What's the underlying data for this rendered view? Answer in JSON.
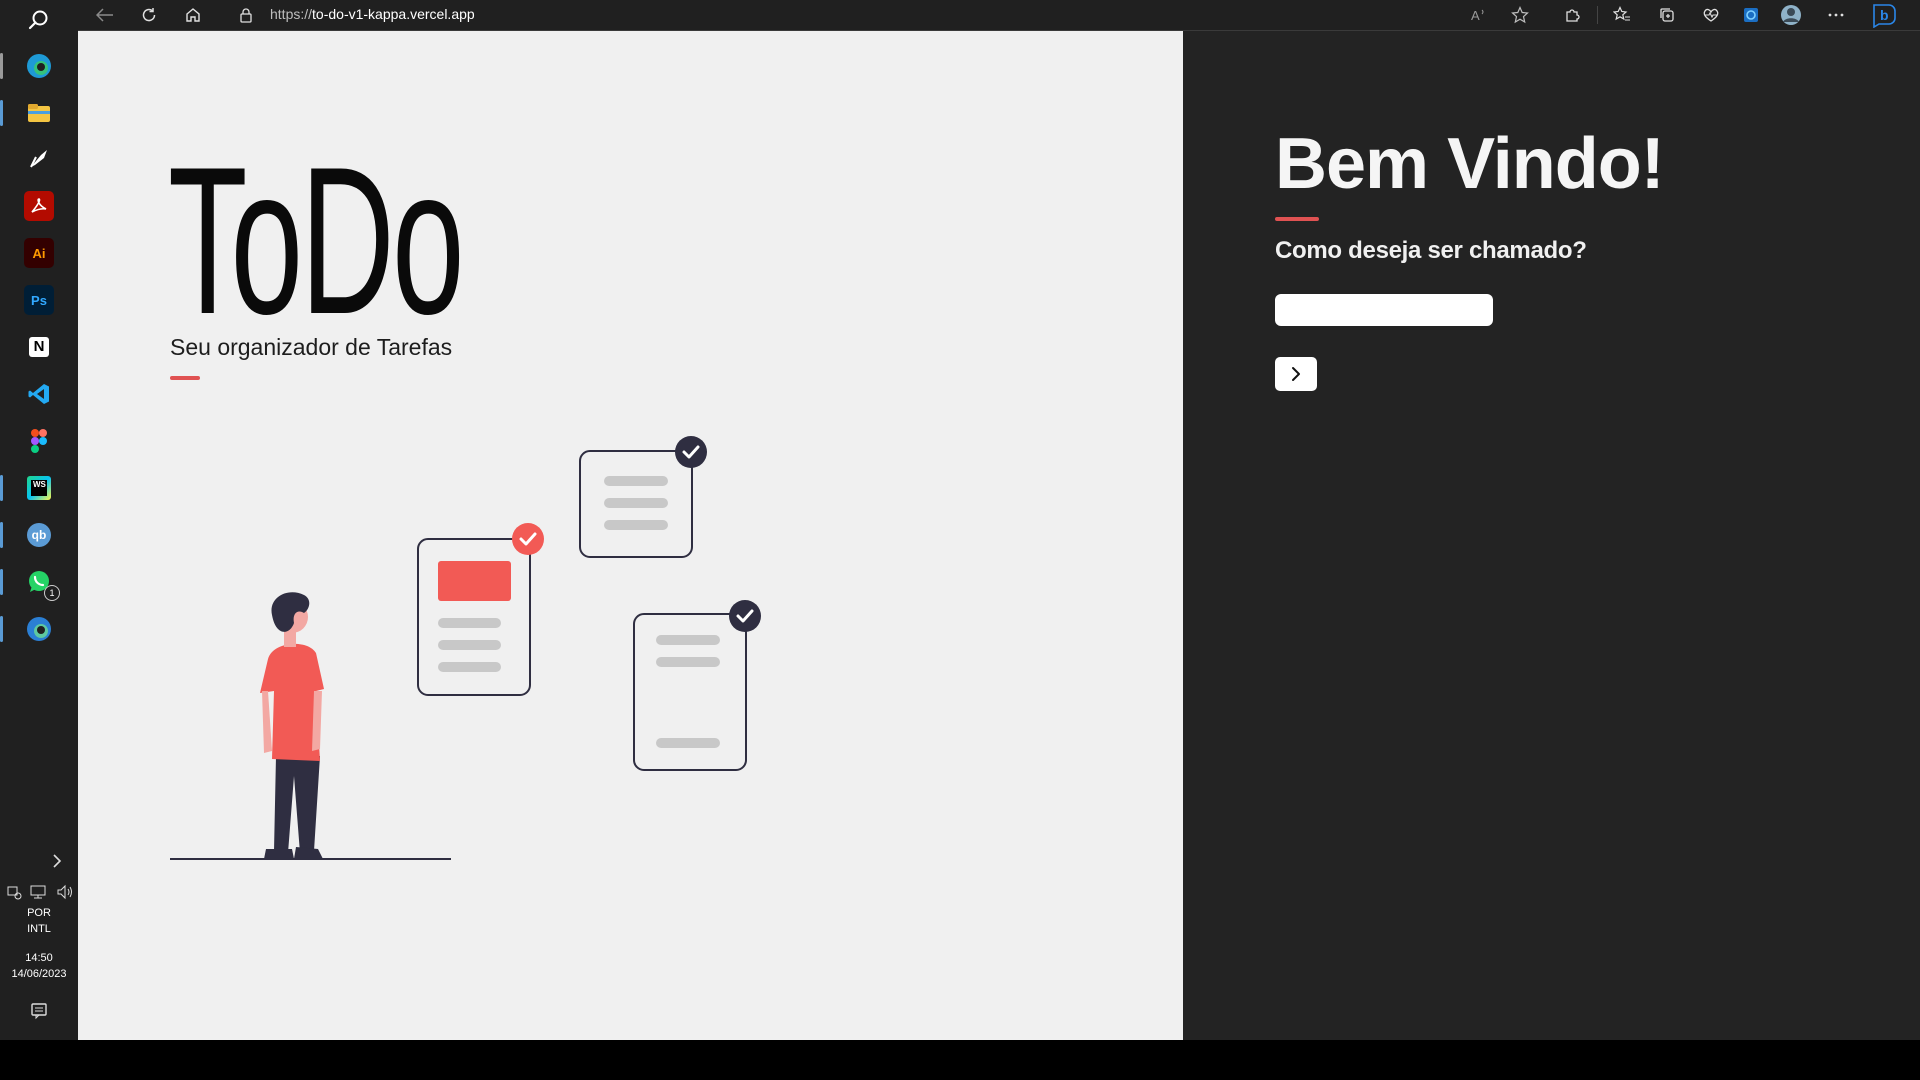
{
  "browser": {
    "url_scheme": "https://",
    "url_host": "to-do-v1-kappa.vercel.app",
    "toolbar_icons": [
      "back-icon",
      "refresh-icon",
      "home-icon",
      "lock-icon",
      "read-aloud-icon",
      "favorite-star-icon",
      "extensions-icon",
      "favorites-list-icon",
      "collections-icon",
      "performance-icon",
      "edge-bar-icon",
      "profile-avatar-icon",
      "more-icon",
      "bing-chat-icon"
    ]
  },
  "taskbar": {
    "apps": [
      "search-icon",
      "edge-icon",
      "file-explorer-icon",
      "feather-app-icon",
      "acrobat-icon",
      "illustrator-icon",
      "photoshop-icon",
      "notion-icon",
      "vscode-icon",
      "figma-icon",
      "webstorm-icon",
      "qbittorrent-icon",
      "whatsapp-icon",
      "edge-dev-icon"
    ],
    "whatsapp_badge": "1",
    "lang_line1": "POR",
    "lang_line2": "INTL",
    "time": "14:50",
    "date": "14/06/2023"
  },
  "hero": {
    "logo": "ToDo",
    "subtitle": "Seu organizador de Tarefas"
  },
  "login": {
    "title": "Bem Vindo!",
    "question": "Como deseja ser chamado?",
    "input_placeholder": "",
    "input_value": ""
  },
  "colors": {
    "accent": "#e05252",
    "dark_panel": "#232323",
    "light_panel": "#f0f0f0",
    "illustration_dark": "#2f2e41"
  }
}
